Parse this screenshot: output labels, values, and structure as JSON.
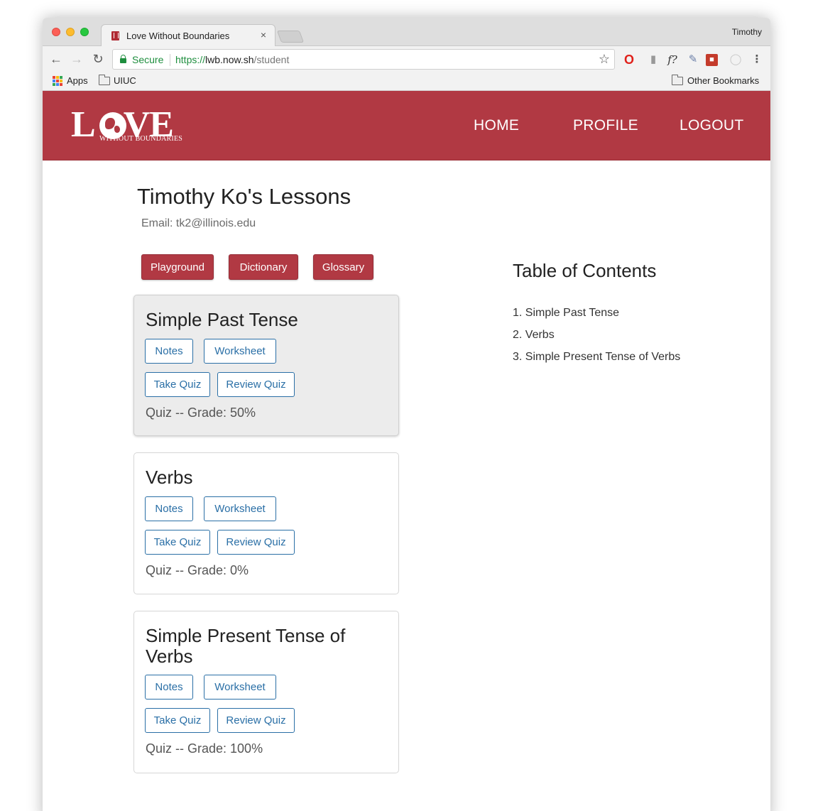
{
  "browser": {
    "tab_title": "Love Without Boundaries",
    "tab_close": "×",
    "profile_name": "Timothy",
    "secure_label": "Secure",
    "url_scheme": "https://",
    "url_host": "lwb.now.sh",
    "url_path": "/student",
    "bookmarks": {
      "apps": "Apps",
      "uiuc": "UIUC",
      "other": "Other Bookmarks"
    }
  },
  "header": {
    "logo_word_l": "L",
    "logo_word_ve": "VE",
    "logo_tagline": "WITHOUT BOUNDARIES",
    "nav": {
      "home": "HOME",
      "profile": "PROFILE",
      "logout": "LOGOUT"
    },
    "brand_color": "#b13943"
  },
  "main": {
    "title": "Timothy Ko's Lessons",
    "email": "Email: tk2@illinois.edu",
    "buttons": {
      "playground": "Playground",
      "dictionary": "Dictionary",
      "glossary": "Glossary"
    },
    "lessons": [
      {
        "title": "Simple Past Tense",
        "notes": "Notes",
        "worksheet": "Worksheet",
        "take_quiz": "Take Quiz",
        "review_quiz": "Review Quiz",
        "grade": "Quiz -- Grade: 50%"
      },
      {
        "title": "Verbs",
        "notes": "Notes",
        "worksheet": "Worksheet",
        "take_quiz": "Take Quiz",
        "review_quiz": "Review Quiz",
        "grade": "Quiz -- Grade: 0%"
      },
      {
        "title": "Simple Present Tense of Verbs",
        "notes": "Notes",
        "worksheet": "Worksheet",
        "take_quiz": "Take Quiz",
        "review_quiz": "Review Quiz",
        "grade": "Quiz -- Grade: 100%"
      }
    ],
    "toc": {
      "title": "Table of Contents",
      "items": [
        "1. Simple Past Tense",
        "2. Verbs",
        "3. Simple Present Tense of Verbs"
      ]
    }
  }
}
